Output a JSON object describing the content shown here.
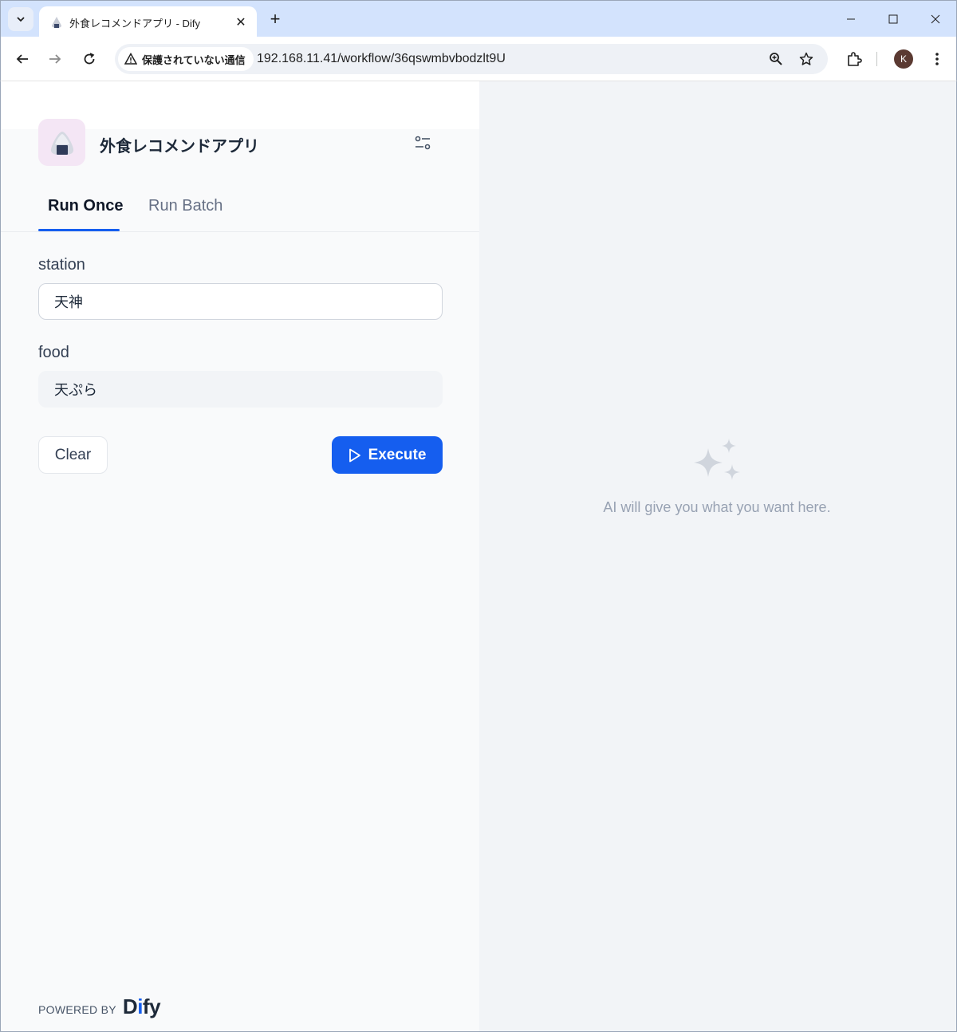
{
  "browser": {
    "tab_title": "外食レコメンドアプリ - Dify",
    "security_label": "保護されていない通信",
    "url": "192.168.11.41/workflow/36qswmbvbodzlt9U",
    "profile_initial": "K"
  },
  "app": {
    "title": "外食レコメンドアプリ",
    "tabs": [
      {
        "label": "Run Once",
        "active": true
      },
      {
        "label": "Run Batch",
        "active": false
      }
    ],
    "fields": [
      {
        "label": "station",
        "value": "天神"
      },
      {
        "label": "food",
        "value": "天ぷら"
      }
    ],
    "clear_label": "Clear",
    "execute_label": "Execute",
    "powered_by": "POWERED BY",
    "logo_text": "Dify",
    "empty_message": "AI will give you what you want here.",
    "colors": {
      "accent": "#155eef"
    }
  }
}
